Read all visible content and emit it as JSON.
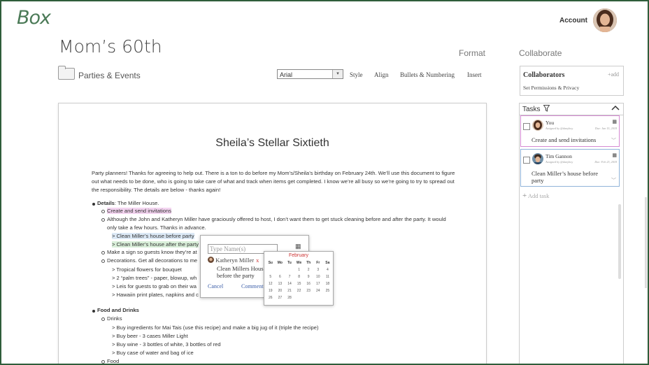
{
  "app": {
    "logo": "Box"
  },
  "header": {
    "account_label": "Account"
  },
  "document": {
    "title": "Mom’s 60th",
    "folder": "Parties & Events",
    "heading": "Sheila’s Stellar Sixtieth",
    "intro": "Party planners! Thanks for agreeing to help out. There is a ton to do before my Mom’s/Sheila’s birthday on February 24th. We’ll use this document to figure out what needs to be done, who is going to take care of what and track when items get completed. I know we’re all busy so we’re going to try to spread out the responsibility. The details are below - thanks again!",
    "lines": {
      "details_label": "Details",
      "details_value": ": The Miller House.",
      "invites": "Create and send invitations",
      "hosts1": "Although the John and Katheryn Miller have graciously offered to host, I don’t want them to get stuck cleaning before and after the party. It would",
      "hosts2": "only take a few hours. Thanks in advance.",
      "clean_before": "Clean Miller’s house before party",
      "clean_after": "Clean Miller’s house after the party",
      "sign": "Make a sign so guests know they’re at",
      "decor": "Decorations. Get all decorations to me",
      "flowers": "> Tropical flowers for bouquet",
      "palm": "> 2 “palm trees” - paper, blowup, wh",
      "leis": "> Leis for guests to grab on their wa",
      "hawaiin": "> Hawaiin print plates, napkins and c",
      "food_drinks": "Food and Drinks",
      "drinks": "Drinks",
      "mai_tai": "> Buy ingredients for Mai Tais (use this recipe) and make a big jug of it (triple the recipe)",
      "beer": "> Buy beer - 3 cases Miller Light",
      "wine": "> Buy wine - 3 bottles of white, 3 bottles of red",
      "water": "> Buy case of water and bag of ice",
      "food": "Food"
    }
  },
  "nav": {
    "format": "Format",
    "collaborate": "Collaborate"
  },
  "toolbar": {
    "font": "Arial",
    "style": "Style",
    "align": "Align",
    "bullets": "Bullets & Numbering",
    "insert": "Insert"
  },
  "assign_popup": {
    "placeholder": "Type Name(s)",
    "person": "Katheryn Miller",
    "remove": "x",
    "task_text": "Clean Millers House before the party",
    "cancel": "Cancel",
    "comment": "Comment"
  },
  "calendar": {
    "month": "February",
    "days": [
      "Su",
      "Mo",
      "Tu",
      "We",
      "Th",
      "Fr",
      "Sa"
    ],
    "weeks": [
      [
        "",
        "",
        "",
        "",
        "",
        "",
        ""
      ],
      [
        "",
        "",
        "",
        "1",
        "2",
        "3",
        "4"
      ],
      [
        "5",
        "6",
        "7",
        "8",
        "9",
        "10",
        "11"
      ],
      [
        "12",
        "13",
        "14",
        "15",
        "16",
        "17",
        "18"
      ],
      [
        "19",
        "20",
        "21",
        "22",
        "23",
        "24",
        "25"
      ],
      [
        "26",
        "27",
        "28",
        "",
        "",
        "",
        ""
      ]
    ]
  },
  "collaborators": {
    "title": "Collaborators",
    "add": "+add",
    "subtitle": "Set Permissions & Privacy"
  },
  "tasks": {
    "title": "Tasks",
    "items": [
      {
        "assignee": "You",
        "assigned_by": "Assigned by @danyboy",
        "due": "Due: Jan 15, 2018",
        "text": "Create and send invitations"
      },
      {
        "assignee": "Tim Gannon",
        "assigned_by": "Assigned by @danyboy",
        "due": "Due: Feb 23, 2018",
        "text": "Clean Miller’s house before party"
      }
    ],
    "add_task": "Add task"
  }
}
